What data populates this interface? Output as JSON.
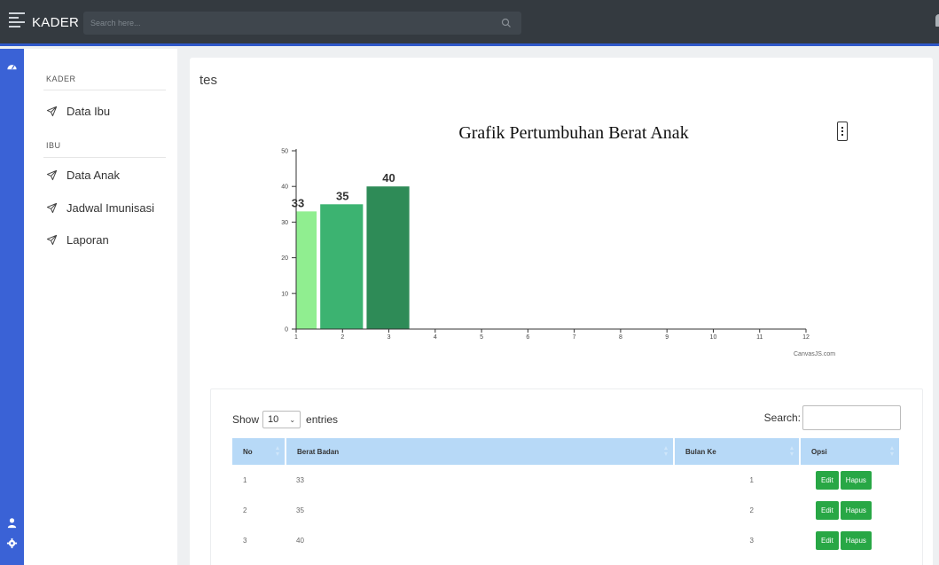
{
  "topbar": {
    "brand": "KADER",
    "search_placeholder": "Search here..."
  },
  "sidebar": {
    "sections": [
      {
        "title": "KADER",
        "items": [
          {
            "label": "Data Ibu",
            "icon": "paper-plane-icon"
          }
        ]
      },
      {
        "title": "IBU",
        "items": [
          {
            "label": "Data Anak",
            "icon": "paper-plane-icon"
          },
          {
            "label": "Jadwal Imunisasi",
            "icon": "paper-plane-icon"
          },
          {
            "label": "Laporan",
            "icon": "paper-plane-icon"
          }
        ]
      }
    ]
  },
  "main": {
    "title": "tes"
  },
  "chart_data": {
    "type": "bar",
    "title": "Grafik Pertumbuhan Berat Anak",
    "x": [
      1,
      2,
      3
    ],
    "values": [
      33,
      35,
      40
    ],
    "data_labels": [
      "33",
      "35",
      "40"
    ],
    "colors": [
      "#90ee90",
      "#3cb371",
      "#2e8b57"
    ],
    "x_ticks": [
      "1",
      "2",
      "3",
      "4",
      "5",
      "6",
      "7",
      "8",
      "9",
      "10",
      "11",
      "12"
    ],
    "y_ticks": [
      "0",
      "10",
      "20",
      "30",
      "40",
      "50"
    ],
    "ylim": [
      0,
      50
    ],
    "xlim": [
      1,
      12
    ],
    "grid": false,
    "credit": "CanvasJS.com"
  },
  "table": {
    "show_label": "Show",
    "entries_label": "entries",
    "page_length": "10",
    "search_label": "Search:",
    "columns": [
      "No",
      "Berat Badan",
      "Bulan Ke",
      "Opsi"
    ],
    "rows": [
      {
        "no": "1",
        "berat": "33",
        "bulan": "1"
      },
      {
        "no": "2",
        "berat": "35",
        "bulan": "2"
      },
      {
        "no": "3",
        "berat": "40",
        "bulan": "3"
      }
    ],
    "edit_label": "Edit",
    "delete_label": "Hapus"
  },
  "colors": {
    "topbar": "#343a40",
    "sidebar": "#3a62d6",
    "accent_line": "#2f58c9",
    "table_header": "#b7d9f7",
    "button": "#28a745"
  }
}
